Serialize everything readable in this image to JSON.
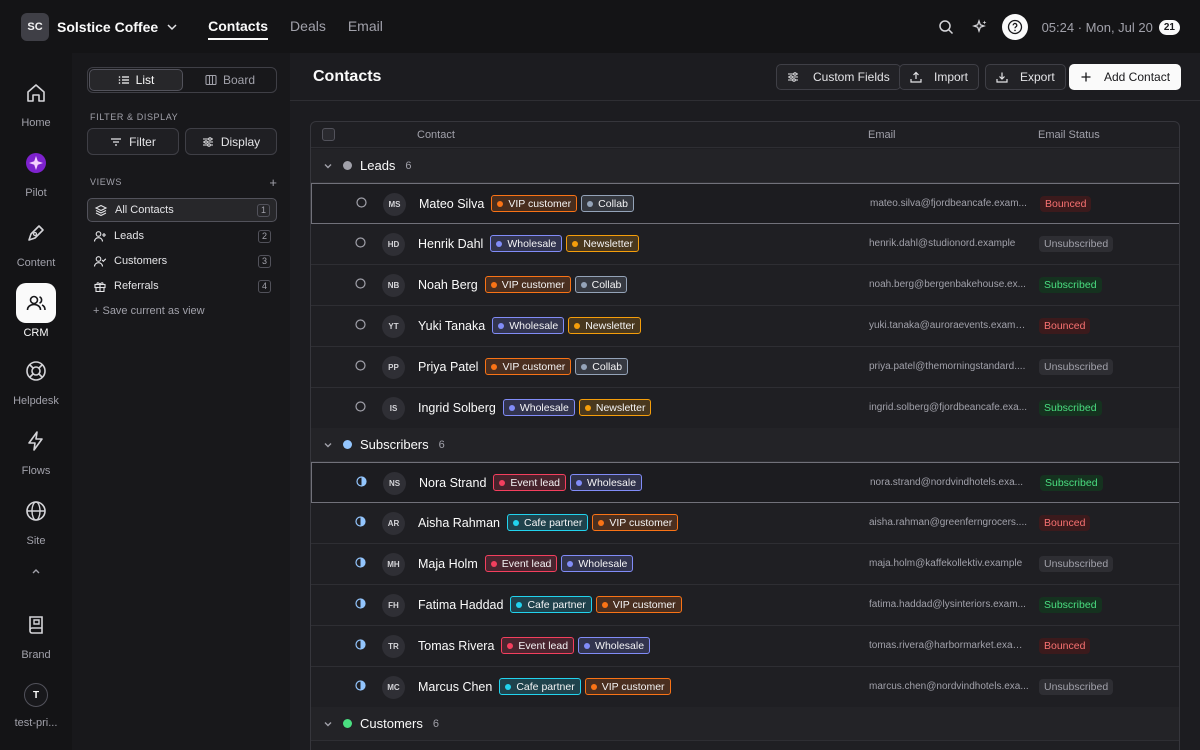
{
  "workspace": {
    "initials": "SC",
    "name": "Solstice Coffee"
  },
  "topnav": {
    "tabs": [
      "Contacts",
      "Deals",
      "Email"
    ]
  },
  "clock": {
    "time": "05:24 · Mon, Jul 20",
    "badge": "21"
  },
  "rail": {
    "home": "Home",
    "pilot": "Pilot",
    "content": "Content",
    "crm": "CRM",
    "helpdesk": "Helpdesk",
    "flows": "Flows",
    "site": "Site",
    "brand": "Brand",
    "user_initial": "T",
    "user_label": "test-pri..."
  },
  "sidebar": {
    "list_label": "List",
    "board_label": "Board",
    "filter_display_heading": "FILTER & DISPLAY",
    "filter_label": "Filter",
    "display_label": "Display",
    "views_heading": "VIEWS",
    "views": [
      {
        "label": "All Contacts",
        "count": "1"
      },
      {
        "label": "Leads",
        "count": "2"
      },
      {
        "label": "Customers",
        "count": "3"
      },
      {
        "label": "Referrals",
        "count": "4"
      }
    ],
    "save_view": "+ Save current as view"
  },
  "main": {
    "title": "Contacts",
    "buttons": {
      "custom_fields": "Custom Fields",
      "import": "Import",
      "export": "Export",
      "add_contact": "Add Contact"
    },
    "columns": {
      "contact": "Contact",
      "email": "Email",
      "email_status": "Email Status"
    },
    "groups": [
      {
        "name": "Leads",
        "count": "6",
        "color": "#a1a1aa"
      },
      {
        "name": "Subscribers",
        "count": "6",
        "color": "#93c5fd"
      },
      {
        "name": "Customers",
        "count": "6",
        "color": "#4ade80"
      }
    ],
    "rows": [
      {
        "initials": "MS",
        "name": "Mateo Silva",
        "tags": [
          "VIP customer",
          "Collab"
        ],
        "email": "mateo.silva@fjordbeancafe.exam...",
        "status": "Bounced"
      },
      {
        "initials": "HD",
        "name": "Henrik Dahl",
        "tags": [
          "Wholesale",
          "Newsletter"
        ],
        "email": "henrik.dahl@studionord.example",
        "status": "Unsubscribed"
      },
      {
        "initials": "NB",
        "name": "Noah Berg",
        "tags": [
          "VIP customer",
          "Collab"
        ],
        "email": "noah.berg@bergenbakehouse.ex...",
        "status": "Subscribed"
      },
      {
        "initials": "YT",
        "name": "Yuki Tanaka",
        "tags": [
          "Wholesale",
          "Newsletter"
        ],
        "email": "yuki.tanaka@auroraevents.examp...",
        "status": "Bounced"
      },
      {
        "initials": "PP",
        "name": "Priya Patel",
        "tags": [
          "VIP customer",
          "Collab"
        ],
        "email": "priya.patel@themorningstandard....",
        "status": "Unsubscribed"
      },
      {
        "initials": "IS",
        "name": "Ingrid Solberg",
        "tags": [
          "Wholesale",
          "Newsletter"
        ],
        "email": "ingrid.solberg@fjordbeancafe.exa...",
        "status": "Subscribed"
      },
      {
        "initials": "NS",
        "name": "Nora Strand",
        "tags": [
          "Event lead",
          "Wholesale"
        ],
        "email": "nora.strand@nordvindhotels.exa...",
        "status": "Subscribed"
      },
      {
        "initials": "AR",
        "name": "Aisha Rahman",
        "tags": [
          "Cafe partner",
          "VIP customer"
        ],
        "email": "aisha.rahman@greenferngrocers....",
        "status": "Bounced"
      },
      {
        "initials": "MH",
        "name": "Maja Holm",
        "tags": [
          "Event lead",
          "Wholesale"
        ],
        "email": "maja.holm@kaffekollektiv.example",
        "status": "Unsubscribed"
      },
      {
        "initials": "FH",
        "name": "Fatima Haddad",
        "tags": [
          "Cafe partner",
          "VIP customer"
        ],
        "email": "fatima.haddad@lysinteriors.exam...",
        "status": "Subscribed"
      },
      {
        "initials": "TR",
        "name": "Tomas Rivera",
        "tags": [
          "Event lead",
          "Wholesale"
        ],
        "email": "tomas.rivera@harbormarket.exam...",
        "status": "Bounced"
      },
      {
        "initials": "MC",
        "name": "Marcus Chen",
        "tags": [
          "Cafe partner",
          "VIP customer"
        ],
        "email": "marcus.chen@nordvindhotels.exa...",
        "status": "Unsubscribed"
      }
    ]
  },
  "tag_colors": {
    "VIP customer": "#f97316",
    "Collab": "#94a3b8",
    "Wholesale": "#818cf8",
    "Newsletter": "#f59e0b",
    "Event lead": "#f43f5e",
    "Cafe partner": "#22d3ee"
  }
}
